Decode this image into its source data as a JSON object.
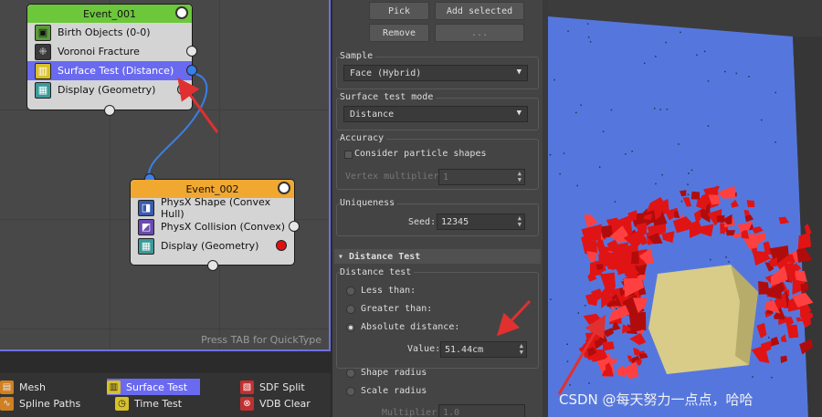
{
  "graph": {
    "quicktype_hint": "Press TAB for QuickType",
    "event1": {
      "title": "Event_001",
      "rows": [
        {
          "label": "Birth Objects (0-0)",
          "icon": "birth-objects-icon"
        },
        {
          "label": "Voronoi Fracture",
          "icon": "voronoi-fracture-icon"
        },
        {
          "label": "Surface Test (Distance)",
          "icon": "surface-test-icon"
        },
        {
          "label": "Display (Geometry)",
          "icon": "display-icon"
        }
      ]
    },
    "event2": {
      "title": "Event_002",
      "rows": [
        {
          "label": "PhysX Shape (Convex Hull)",
          "icon": "physx-shape-icon"
        },
        {
          "label": "PhysX Collision (Convex)",
          "icon": "physx-collision-icon"
        },
        {
          "label": "Display (Geometry)",
          "icon": "display-icon"
        }
      ]
    }
  },
  "palette": {
    "items": [
      {
        "label": "Mesh"
      },
      {
        "label": "Spline Paths"
      },
      {
        "label": "Surface Test"
      },
      {
        "label": "Time Test"
      },
      {
        "label": "SDF Split"
      },
      {
        "label": "VDB Clear"
      }
    ]
  },
  "props": {
    "pick": "Pick",
    "add_selected": "Add selected",
    "remove": "Remove",
    "more": "...",
    "sample": {
      "title": "Sample",
      "value": "Face (Hybrid)"
    },
    "surface_mode": {
      "title": "Surface test mode",
      "value": "Distance"
    },
    "accuracy": {
      "title": "Accuracy",
      "consider": "Consider particle shapes",
      "vertex_label": "Vertex multiplier:",
      "vertex_value": "1"
    },
    "uniqueness": {
      "title": "Uniqueness",
      "seed_label": "Seed:",
      "seed_value": "12345"
    },
    "distance_test": {
      "rollout": "Distance Test",
      "group": "Distance test",
      "less": "Less than:",
      "greater": "Greater than:",
      "absolute": "Absolute distance:",
      "value_label": "Value:",
      "value": "51.44cm",
      "shape_radius": "Shape radius",
      "scale_radius": "Scale radius",
      "multiplier_label": "Multiplier:",
      "multiplier_value": "1.0"
    }
  },
  "viewport": {
    "watermark": "CSDN @每天努力一点点，哈哈"
  },
  "colors": {
    "selection": "#6a6af0",
    "event1_header": "#6cc73a",
    "event2_header": "#f0a830",
    "wall": "#5577dd",
    "fragments": "#e01414",
    "cube": "#d8cc88",
    "arrow": "#e03030"
  }
}
